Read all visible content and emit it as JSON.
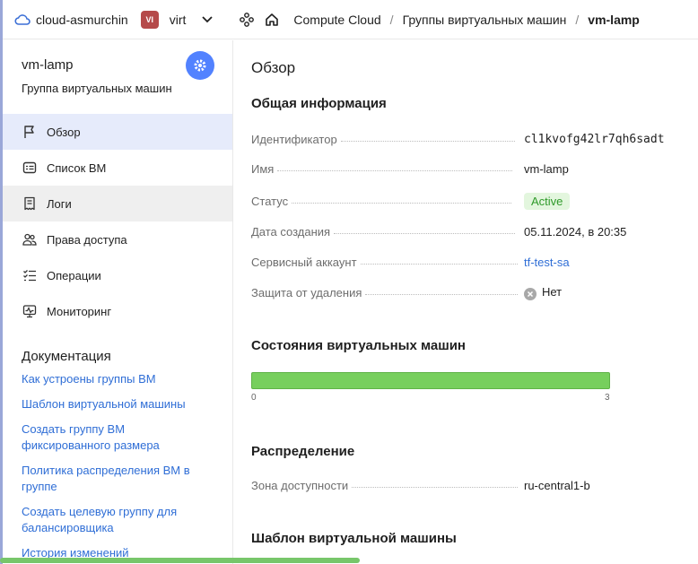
{
  "topbar": {
    "cloud_name": "cloud-asmurchin",
    "folder_badge": "VI",
    "folder_name": "virt",
    "breadcrumbs": [
      "Compute Cloud",
      "Группы виртуальных машин",
      "vm-lamp"
    ],
    "separator": "/"
  },
  "sidebar": {
    "title": "vm-lamp",
    "subtitle": "Группа виртуальных машин",
    "nav": [
      {
        "label": "Обзор",
        "icon": "flag-icon"
      },
      {
        "label": "Список ВМ",
        "icon": "vm-list-icon"
      },
      {
        "label": "Логи",
        "icon": "logs-icon"
      },
      {
        "label": "Права доступа",
        "icon": "users-icon"
      },
      {
        "label": "Операции",
        "icon": "operations-icon"
      },
      {
        "label": "Мониторинг",
        "icon": "monitoring-icon"
      }
    ],
    "docs_title": "Документация",
    "docs": [
      "Как устроены группы ВМ",
      "Шаблон виртуальной машины",
      "Создать группу ВМ фиксированного размера",
      "Политика распределения ВМ в группе",
      "Создать целевую группу для балансировщика",
      "История изменений"
    ]
  },
  "main": {
    "title": "Обзор",
    "general": {
      "title": "Общая информация",
      "rows": [
        {
          "label": "Идентификатор",
          "value": "cl1kvofg42lr7qh6sadt"
        },
        {
          "label": "Имя",
          "value": "vm-lamp"
        },
        {
          "label": "Статус",
          "value": "Active"
        },
        {
          "label": "Дата создания",
          "value": "05.11.2024, в 20:35"
        },
        {
          "label": "Сервисный аккаунт",
          "value": "tf-test-sa"
        },
        {
          "label": "Защита от удаления",
          "value": "Нет"
        }
      ]
    },
    "vm_states": {
      "title": "Состояния виртуальных машин",
      "min": "0",
      "max": "3",
      "running_fraction": 1.0
    },
    "distribution": {
      "title": "Распределение",
      "zone_label": "Зона доступности",
      "zone_value": "ru-central1-b"
    },
    "template_title": "Шаблон виртуальной машины"
  }
}
